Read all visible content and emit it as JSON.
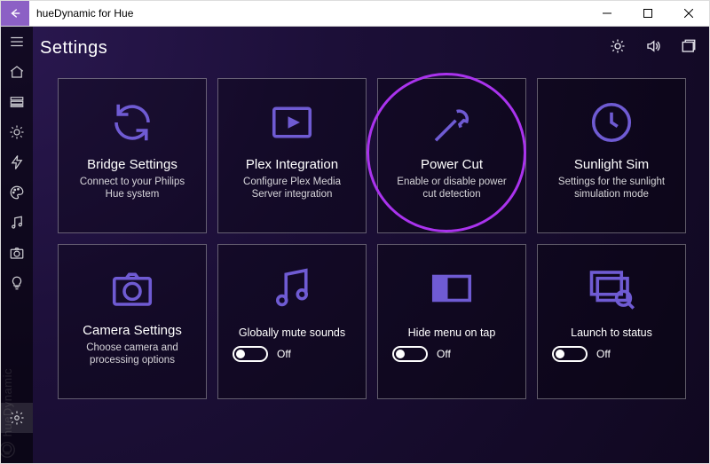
{
  "window": {
    "title": "hueDynamic for Hue"
  },
  "page": {
    "heading": "Settings"
  },
  "brand": "hueDynamic",
  "tiles": {
    "bridge": {
      "title": "Bridge Settings",
      "desc": "Connect to your Philips Hue system"
    },
    "plex": {
      "title": "Plex Integration",
      "desc": "Configure Plex Media Server integration"
    },
    "powercut": {
      "title": "Power Cut",
      "desc": "Enable or disable power cut detection"
    },
    "sunlight": {
      "title": "Sunlight Sim",
      "desc": "Settings for the sunlight simulation mode"
    },
    "camera": {
      "title": "Camera Settings",
      "desc": "Choose camera and processing options"
    },
    "mute": {
      "title": "Globally mute sounds",
      "state": "Off"
    },
    "hidemenu": {
      "title": "Hide menu on tap",
      "state": "Off"
    },
    "launch": {
      "title": "Launch to status",
      "state": "Off"
    }
  }
}
